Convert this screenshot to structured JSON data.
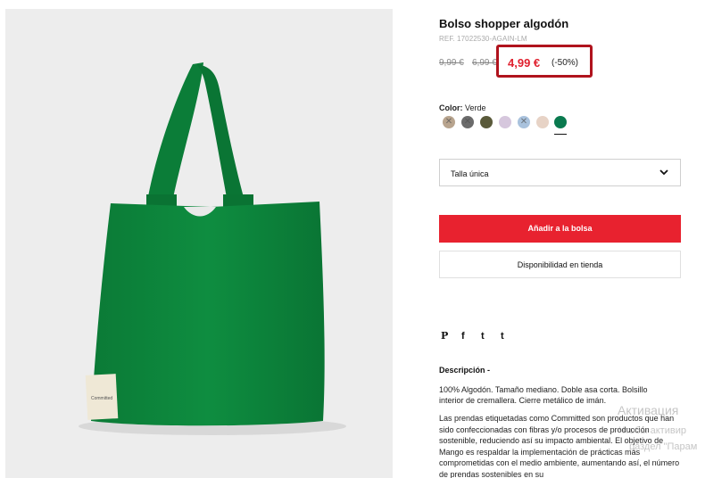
{
  "product": {
    "title": "Bolso shopper algodón",
    "ref": "REF. 17022530-AGAIN-LM",
    "old_price_1": "9,99 €",
    "old_price_2": "6,99 €",
    "price": "4,99 €",
    "discount": "(-50%)",
    "price_color": "#e0212f",
    "highlight_color": "#b0131d"
  },
  "color": {
    "label": "Color:",
    "selected": "Verde",
    "swatches": [
      {
        "color": "#b8a48e",
        "available": false
      },
      {
        "color": "#6b6b6b",
        "available": false
      },
      {
        "color": "#5a5a3a",
        "available": true
      },
      {
        "color": "#d6c7dd",
        "available": true
      },
      {
        "color": "#a9c2dd",
        "available": false
      },
      {
        "color": "#e7d3c6",
        "available": true
      },
      {
        "color": "#0a7a4f",
        "available": true,
        "selected": true
      }
    ]
  },
  "size": {
    "value": "Talla única",
    "icon": "chevron-down-icon"
  },
  "actions": {
    "add_to_bag": "Añadir a la bolsa",
    "availability": "Disponibilidad en tienda",
    "add_color": "#e8222f"
  },
  "social": {
    "pinterest": "P",
    "facebook": "f",
    "twitter": "t",
    "tumblr": "t"
  },
  "description": {
    "heading": "Descripción  -",
    "p1": "100% Algodón. Tamaño mediano. Doble asa corta. Bolsillo interior de cremallera. Cierre metálico de imán.",
    "p2": "Las prendas etiquetadas como Committed son productos que han sido confeccionadas con fibras y/o procesos de producción sostenible, reduciendo así su impacto ambiental. El objetivo de Mango es respaldar la implementación de prácticas más comprometidas con el medio ambiente, aumentando así, el número de prendas sostenibles en su"
  },
  "overlay": {
    "line1": "Активация",
    "line2": "Чтобы активир",
    "line3": "раздел \"Парам"
  },
  "photo": {
    "bag_color": "#0c8a3e",
    "label_text": "Committed"
  }
}
